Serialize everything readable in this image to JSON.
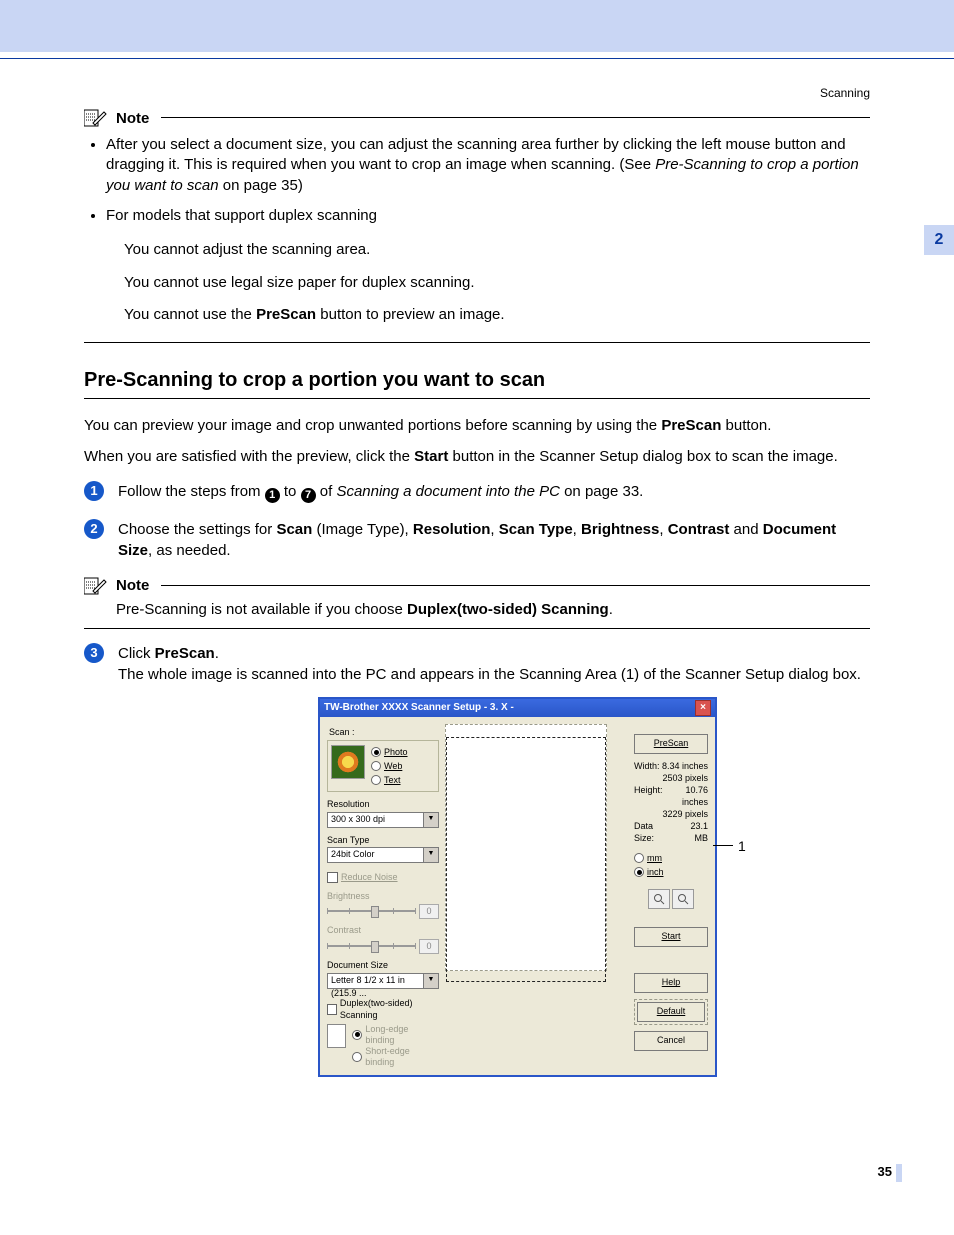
{
  "header": {
    "section": "Scanning",
    "chapter_tab": "2"
  },
  "note1": {
    "title": "Note",
    "bullet1_a": "After you select a document size, you can adjust the scanning area further by clicking the left mouse button and dragging it. This is required when you want to crop an image when scanning. (See ",
    "bullet1_link": "Pre-Scanning to crop a portion you want to scan",
    "bullet1_b": " on page 35)",
    "bullet2": "For models that support duplex scanning",
    "sub1": "You cannot adjust the scanning area.",
    "sub2": "You cannot use legal size paper for duplex scanning.",
    "sub3_a": "You cannot use the ",
    "sub3_b": "PreScan",
    "sub3_c": " button to preview an image."
  },
  "section": {
    "heading": "Pre-Scanning to crop a portion you want to scan",
    "p1_a": "You can preview your image and crop unwanted portions before scanning by using the ",
    "p1_b": "PreScan",
    "p1_c": " button.",
    "p2_a": "When you are satisfied with the preview, click the ",
    "p2_b": "Start",
    "p2_c": " button in the Scanner Setup dialog box to scan the image."
  },
  "steps": {
    "s1_a": "Follow the steps from ",
    "s1_b": " to ",
    "s1_c": " of ",
    "s1_link": "Scanning a document into the PC",
    "s1_d": " on page 33.",
    "s1_num1": "1",
    "s1_num7": "7",
    "s2_a": "Choose the settings for ",
    "s2_b": "Scan",
    "s2_c": " (Image Type), ",
    "s2_d": "Resolution",
    "s2_e": ", ",
    "s2_f": "Scan Type",
    "s2_g": ", ",
    "s2_h": "Brightness",
    "s2_i": ", ",
    "s2_j": "Contrast",
    "s2_k": " and ",
    "s2_l": "Document Size",
    "s2_m": ", as needed.",
    "note2_title": "Note",
    "note2_a": "Pre-Scanning is not available if you choose ",
    "note2_b": "Duplex(two-sided) Scanning",
    "note2_c": ".",
    "s3_a": "Click ",
    "s3_b": "PreScan",
    "s3_c": ".",
    "s3_d": "The whole image is scanned into the PC and appears in the Scanning Area (1) of the Scanner Setup dialog box."
  },
  "dialog": {
    "title": "TW-Brother XXXX Scanner Setup - 3. X -",
    "scan_label": "Scan :",
    "photo": "Photo",
    "web": "Web",
    "text": "Text",
    "resolution_label": "Resolution",
    "resolution_value": "300 x 300 dpi",
    "scantype_label": "Scan Type",
    "scantype_value": "24bit Color",
    "reduce_noise": "Reduce Noise",
    "brightness_label": "Brightness",
    "brightness_value": "0",
    "contrast_label": "Contrast",
    "contrast_value": "0",
    "docsize_label": "Document Size",
    "docsize_value": "Letter 8 1/2 x 11 in (215.9 ...",
    "duplex_label": "Duplex(two-sided) Scanning",
    "long_edge": "Long-edge binding",
    "short_edge": "Short-edge binding",
    "prescan_btn": "PreScan",
    "width_label": "Width:",
    "width_val": "8.34 inches",
    "width_px": "2503 pixels",
    "height_label": "Height:",
    "height_val": "10.76 inches",
    "height_px": "3229 pixels",
    "data_size_label": "Data Size:",
    "data_size_val": "23.1 MB",
    "unit_mm": "mm",
    "unit_inch": "inch",
    "start_btn": "Start",
    "help_btn": "Help",
    "default_btn": "Default",
    "cancel_btn": "Cancel",
    "callout": "1"
  },
  "page": {
    "number": "35"
  }
}
